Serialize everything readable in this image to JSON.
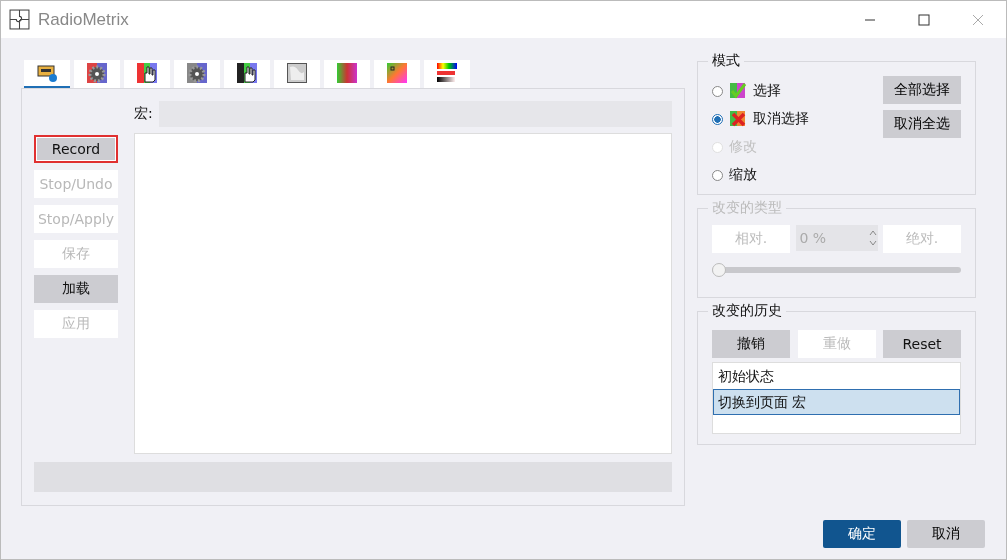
{
  "window": {
    "title": "RadioMetrix"
  },
  "tabs": [
    {
      "selected": true
    },
    {
      "selected": false
    },
    {
      "selected": false
    },
    {
      "selected": false
    },
    {
      "selected": false
    },
    {
      "selected": false
    },
    {
      "selected": false
    },
    {
      "selected": false
    },
    {
      "selected": false
    }
  ],
  "macro": {
    "label": "宏:"
  },
  "macro_buttons": [
    {
      "label": "Record",
      "disabled": false,
      "highlighted": true
    },
    {
      "label": "Stop/Undo",
      "disabled": true,
      "highlighted": false
    },
    {
      "label": "Stop/Apply",
      "disabled": true,
      "highlighted": false
    },
    {
      "label": "保存",
      "disabled": true,
      "highlighted": false
    },
    {
      "label": "加载",
      "disabled": false,
      "highlighted": false
    },
    {
      "label": "应用",
      "disabled": true,
      "highlighted": false
    }
  ],
  "mode": {
    "title": "模式",
    "options": [
      {
        "label": "选择",
        "selected": false,
        "disabled": false,
        "kind": "check"
      },
      {
        "label": "取消选择",
        "selected": true,
        "disabled": false,
        "kind": "cross"
      },
      {
        "label": "修改",
        "selected": false,
        "disabled": true,
        "kind": "plain"
      },
      {
        "label": "缩放",
        "selected": false,
        "disabled": false,
        "kind": "plain"
      }
    ],
    "buttons": [
      "全部选择",
      "取消全选"
    ]
  },
  "change_type": {
    "title": "改变的类型",
    "disabled": true,
    "relative": "相对.",
    "value": "0 %",
    "absolute": "绝对.",
    "level": 0
  },
  "history": {
    "title": "改变的历史",
    "buttons": [
      {
        "label": "撤销",
        "disabled": false
      },
      {
        "label": "重做",
        "disabled": true
      },
      {
        "label": "Reset",
        "disabled": false
      }
    ],
    "items": [
      {
        "label": "初始状态",
        "selected": false
      },
      {
        "label": "切换到页面 宏",
        "selected": true
      }
    ]
  },
  "dialog_buttons": [
    {
      "label": "确定",
      "kind": "primary"
    },
    {
      "label": "取消",
      "kind": "normal"
    }
  ]
}
